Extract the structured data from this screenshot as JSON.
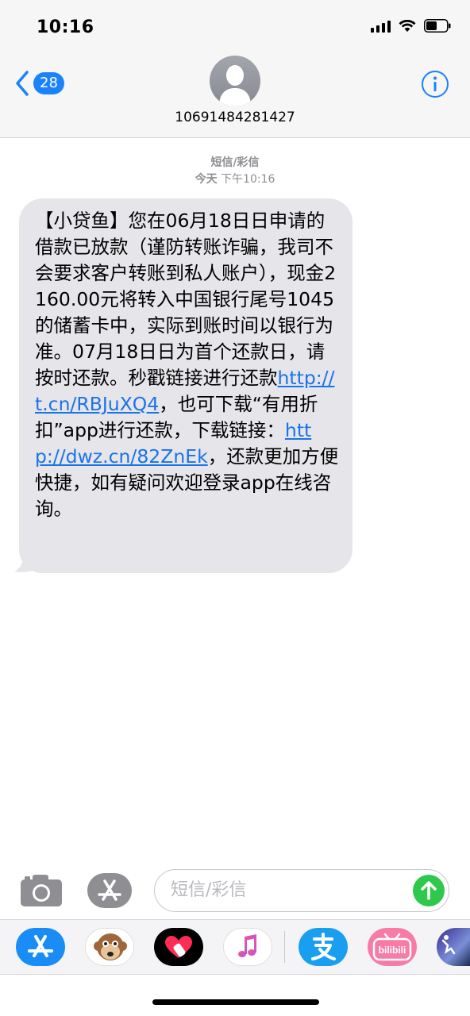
{
  "status": {
    "time": "10:16"
  },
  "header": {
    "back_count": "28",
    "contact": "10691484281427"
  },
  "thread": {
    "message_type": "短信/彩信",
    "timestamp_day": "今天",
    "timestamp_time": "下午10:16"
  },
  "message": {
    "part1": "【小贷鱼】您在06月18日日申请的借款已放款（谨防转账诈骗，我司不会要求客户转账到私人账户），现金2160.00元将转入中国银行尾号1045的储蓄卡中，实际到账时间以银行为准。07月18日日为首个还款日，请按时还款。秒戳链接进行还款",
    "link1": "http://t.cn/RBJuXQ4",
    "part2": "，也可下载“有用折扣”app进行还款，下载链接：",
    "link2": "http://dwz.cn/82ZnEk",
    "part3": "，还款更加方便快捷，如有疑问欢迎登录app在线咨询。"
  },
  "compose": {
    "placeholder": "短信/彩信"
  },
  "apps": [
    "app-store-icon",
    "animoji-monkey-icon",
    "digital-touch-icon",
    "music-icon",
    "alipay-icon",
    "bilibili-icon",
    "photo-app-icon"
  ],
  "colors": {
    "accent": "#1a82fb",
    "bubble": "#e5e5ea",
    "link": "#1a73e8",
    "send": "#2fc84c"
  }
}
